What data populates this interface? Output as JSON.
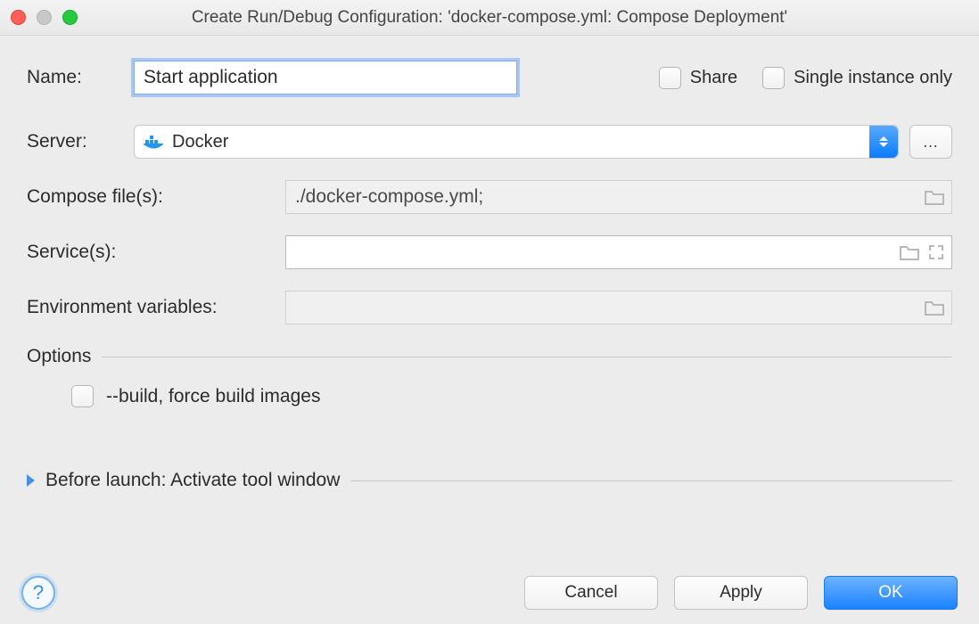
{
  "window": {
    "title": "Create Run/Debug Configuration: 'docker-compose.yml: Compose Deployment'"
  },
  "form": {
    "name_label": "Name:",
    "name_value": "Start application",
    "share_label": "Share",
    "single_instance_label": "Single instance only",
    "server_label": "Server:",
    "server_value": "Docker",
    "more_button": "…",
    "compose_label": "Compose file(s):",
    "compose_value": "./docker-compose.yml;",
    "services_label": "Service(s):",
    "services_value": "",
    "env_label": "Environment variables:",
    "env_value": "",
    "options_section": "Options",
    "build_option": "--build, force build images",
    "before_launch_section": "Before launch: Activate tool window"
  },
  "footer": {
    "help": "?",
    "cancel": "Cancel",
    "apply": "Apply",
    "ok": "OK"
  }
}
